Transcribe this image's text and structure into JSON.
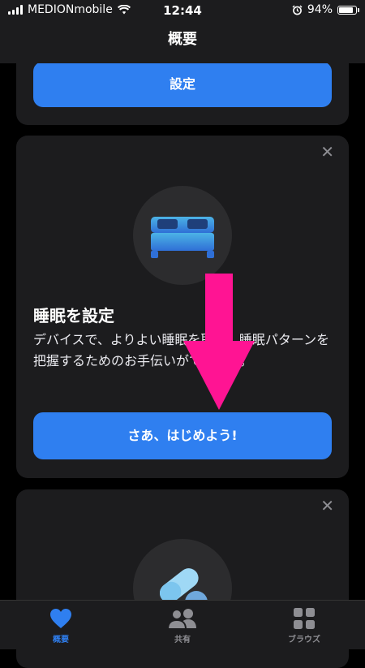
{
  "status_bar": {
    "carrier": "MEDIONmobile",
    "time": "12:44",
    "battery_percent": "94%",
    "battery_level": 0.94
  },
  "nav": {
    "title": "概要"
  },
  "top_card": {
    "button_label": "設定"
  },
  "sleep_card": {
    "title": "睡眠を設定",
    "description": "デバイスで、よりよい睡眠を取り、睡眠パターンを把握するためのお手伝いができます。",
    "button_label": "さあ、はじめよう!",
    "close_glyph": "✕"
  },
  "meds_card": {
    "close_glyph": "✕"
  },
  "tab_bar": {
    "tabs": [
      {
        "label": "概要",
        "icon": "heart-icon",
        "active": true
      },
      {
        "label": "共有",
        "icon": "people-icon",
        "active": false
      },
      {
        "label": "ブラウズ",
        "icon": "grid-icon",
        "active": false
      }
    ]
  },
  "colors": {
    "accent": "#2f7ff0",
    "annotation_arrow": "#ff1493"
  }
}
